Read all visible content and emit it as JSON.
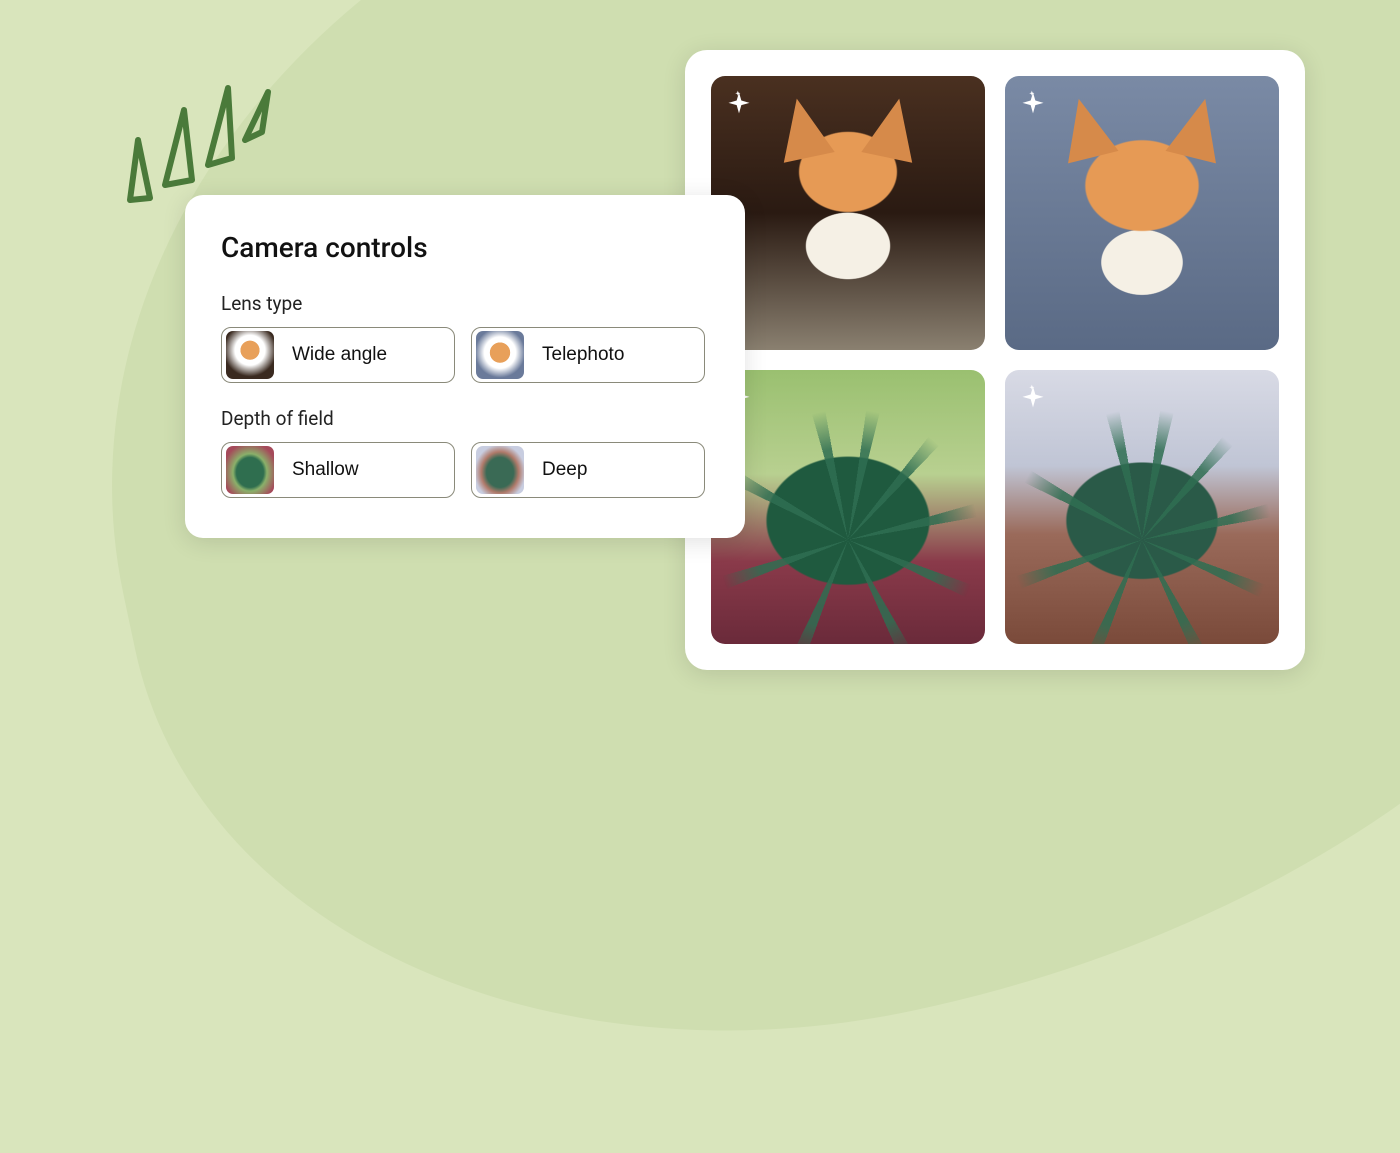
{
  "controls": {
    "title": "Camera controls",
    "groups": [
      {
        "label": "Lens type",
        "options": [
          {
            "label": "Wide angle",
            "thumb": "corgi-wide"
          },
          {
            "label": "Telephoto",
            "thumb": "corgi-tele"
          }
        ]
      },
      {
        "label": "Depth of field",
        "options": [
          {
            "label": "Shallow",
            "thumb": "plant-shallow"
          },
          {
            "label": "Deep",
            "thumb": "plant-deep"
          }
        ]
      }
    ]
  },
  "gallery": {
    "items": [
      {
        "name": "corgi-wide-angle",
        "sparkle": true
      },
      {
        "name": "corgi-telephoto",
        "sparkle": true
      },
      {
        "name": "succulent-shallow",
        "sparkle": true
      },
      {
        "name": "succulent-deep",
        "sparkle": true
      }
    ]
  },
  "icons": {
    "sparkle": "sparkle-icon",
    "emphasis_lines": "emphasis-lines-icon"
  },
  "colors": {
    "background": "#d9e5bc",
    "blob": "#cfdeb0",
    "card": "#ffffff",
    "border": "#8a8a7a",
    "accent_stroke": "#4a7a3a"
  }
}
